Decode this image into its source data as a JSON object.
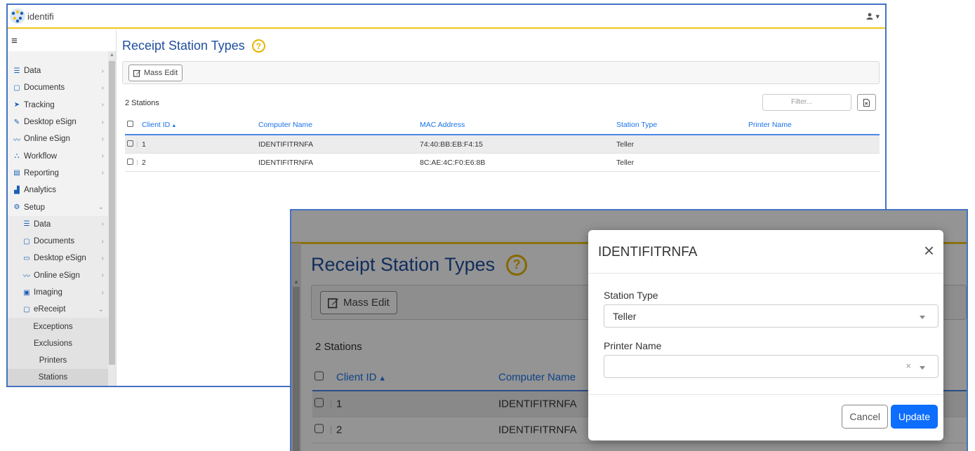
{
  "app": {
    "logo_text": "identifi"
  },
  "sidebar": {
    "items": [
      {
        "label": "Data",
        "icon": "database-icon"
      },
      {
        "label": "Documents",
        "icon": "clipboard-icon"
      },
      {
        "label": "Tracking",
        "icon": "send-icon"
      },
      {
        "label": "Desktop eSign",
        "icon": "pencil-icon"
      },
      {
        "label": "Online eSign",
        "icon": "signature-icon"
      },
      {
        "label": "Workflow",
        "icon": "sitemap-icon"
      },
      {
        "label": "Reporting",
        "icon": "file-icon"
      },
      {
        "label": "Analytics",
        "icon": "chart-icon"
      },
      {
        "label": "Setup",
        "icon": "gear-icon"
      }
    ],
    "setup_items": [
      {
        "label": "Data",
        "icon": "database-icon"
      },
      {
        "label": "Documents",
        "icon": "clipboard-icon"
      },
      {
        "label": "Desktop eSign",
        "icon": "monitor-icon"
      },
      {
        "label": "Online eSign",
        "icon": "signature-icon"
      },
      {
        "label": "Imaging",
        "icon": "image-icon"
      },
      {
        "label": "eReceipt",
        "icon": "receipt-icon"
      }
    ],
    "ereceipt_items": [
      "Exceptions",
      "Exclusions",
      "Printers",
      "Stations"
    ]
  },
  "page": {
    "title": "Receipt Station Types",
    "mass_edit_label": "Mass Edit",
    "count_text": "2 Stations",
    "filter_placeholder": "Filter..."
  },
  "table": {
    "columns": [
      "Client ID",
      "Computer Name",
      "MAC Address",
      "Station Type",
      "Printer Name"
    ],
    "rows": [
      {
        "client_id": "1",
        "computer_name": "IDENTIFITRNFA",
        "mac": "74:40:BB:EB:F4:15",
        "station_type": "Teller",
        "printer_name": ""
      },
      {
        "client_id": "2",
        "computer_name": "IDENTIFITRNFA",
        "mac": "8C:AE:4C:F0:E6:8B",
        "station_type": "Teller",
        "printer_name": ""
      }
    ]
  },
  "modal": {
    "title": "IDENTIFITRNFA",
    "station_type_label": "Station Type",
    "station_type_value": "Teller",
    "printer_name_label": "Printer Name",
    "printer_name_value": "",
    "cancel_label": "Cancel",
    "update_label": "Update"
  },
  "colors": {
    "accent_blue": "#1f4e9e",
    "link_blue": "#1a73e8",
    "header_line": "#f0c419",
    "primary_button": "#0d6efd",
    "callout_border": "#4472c4"
  }
}
